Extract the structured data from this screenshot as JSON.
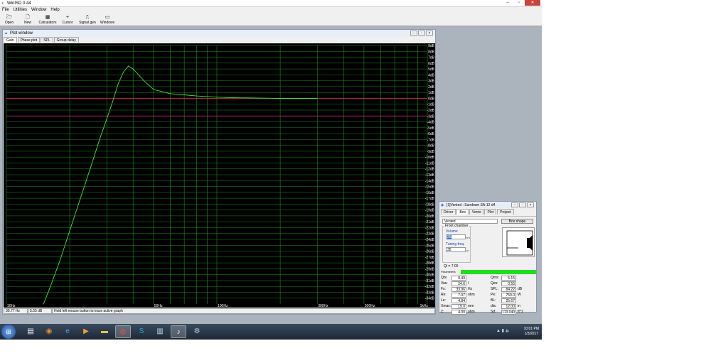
{
  "window": {
    "title": "WinISD 0.44",
    "controls": [
      "–",
      "▫",
      "✕"
    ]
  },
  "menu": [
    "File",
    "Utilities",
    "Window",
    "Help"
  ],
  "toolbar": [
    {
      "label": "Open",
      "icon": "open-folder-icon"
    },
    {
      "label": "New",
      "icon": "new-document-icon"
    },
    {
      "label": "Calculators",
      "icon": "calculator-icon"
    },
    {
      "label": "Cursor",
      "icon": "crosshair-icon"
    },
    {
      "label": "Signal gen",
      "icon": "signal-generator-icon"
    },
    {
      "label": "Windows",
      "icon": "windows-icon"
    }
  ],
  "plot_window": {
    "title": "Plot window",
    "tabs": [
      "Gain",
      "Phase plot",
      "SPL",
      "Group delay"
    ],
    "active_tab": "Gain",
    "status": {
      "freq": "30.77 Hz",
      "value": "5.55 dB",
      "hint": "Hold left mouse button to trace active graph"
    }
  },
  "colors": {
    "plot_bg": "#000000",
    "grid": "#1f8a1f",
    "curve": "#3ee83e",
    "ref_line": "#d03030",
    "minus3_line": "#b03090",
    "progress": "#22dd22"
  },
  "chart_data": {
    "type": "line",
    "x_scale": "log",
    "xlim": [
      10,
      1000
    ],
    "ylim": [
      -35,
      9
    ],
    "x_tick_labels": [
      {
        "value": 10,
        "label": "10Hz"
      },
      {
        "value": 50,
        "label": "50Hz"
      },
      {
        "value": 100,
        "label": "100Hz"
      },
      {
        "value": 300,
        "label": "300Hz"
      },
      {
        "value": 500,
        "label": "500Hz"
      },
      {
        "value": 1000,
        "label": "1kHz"
      }
    ],
    "y_tick_labels": [
      "9dB",
      "8dB",
      "7dB",
      "6dB",
      "5dB",
      "4dB",
      "3dB",
      "2dB",
      "1dB",
      "0dB",
      "-1dB",
      "-2dB",
      "-3dB",
      "-4dB",
      "-5dB",
      "-6dB",
      "-7dB",
      "-8dB",
      "-9dB",
      "-10dB",
      "-11dB",
      "-12dB",
      "-13dB",
      "-14dB",
      "-15dB",
      "-16dB",
      "-17dB",
      "-18dB",
      "-19dB",
      "-20dB",
      "-21dB",
      "-22dB",
      "-23dB",
      "-24dB",
      "-25dB",
      "-26dB",
      "-27dB",
      "-28dB",
      "-29dB",
      "-30dB",
      "-31dB",
      "-32dB",
      "-33dB",
      "-34dB"
    ],
    "y_tick_values": [
      9,
      8,
      7,
      6,
      5,
      4,
      3,
      2,
      1,
      0,
      -1,
      -2,
      -3,
      -4,
      -5,
      -6,
      -7,
      -8,
      -9,
      -10,
      -11,
      -12,
      -13,
      -14,
      -15,
      -16,
      -17,
      -18,
      -19,
      -20,
      -21,
      -22,
      -23,
      -24,
      -25,
      -26,
      -27,
      -28,
      -29,
      -30,
      -31,
      -32,
      -33,
      -34
    ],
    "reference_lines": [
      0,
      -3
    ],
    "series": [
      {
        "x": [
          15,
          16,
          18,
          20,
          22,
          25,
          28,
          30,
          32,
          34,
          36,
          38,
          40,
          45,
          50,
          60,
          70,
          80,
          100,
          120,
          150,
          200,
          250,
          300
        ],
        "y": [
          -35,
          -32.5,
          -27.5,
          -22.5,
          -18,
          -12,
          -6.5,
          -3.5,
          -0.5,
          2.5,
          4.5,
          5.5,
          5.0,
          3.0,
          1.5,
          0.8,
          0.6,
          0.4,
          0.2,
          0.1,
          0.05,
          0.0,
          0.0,
          0.0
        ]
      }
    ]
  },
  "box_window": {
    "title": "[1]Vented : Sundown SA-12 d4",
    "tabs": [
      "Driver",
      "Box",
      "Vents",
      "Plot",
      "Project"
    ],
    "active_tab": "Box",
    "box_type": "Vented",
    "box_shape_label": "Box shape",
    "front_chamber_label": "Front chamber",
    "volume_label": "Volume",
    "volume_value": "35",
    "volume_unit": "ft^3",
    "tuning_label": "Tuning freq.",
    "tuning_value": "35",
    "tuning_unit": "Hz",
    "ql_text": "Ql = 7.00",
    "params_label": "Parameters",
    "params_left": [
      {
        "name": "Qts:",
        "value": "0.49",
        "unit": ""
      },
      {
        "name": "Vas:",
        "value": "24.6",
        "unit": "l"
      },
      {
        "name": "Fs:",
        "value": "33.96",
        "unit": "Hz"
      },
      {
        "name": "Re:",
        "value": "7.07",
        "unit": "ohm"
      },
      {
        "name": "Le:",
        "value": "4.84",
        "unit": ""
      },
      {
        "name": "Xmax:",
        "value": "19.0",
        "unit": "mm"
      },
      {
        "name": "Z:",
        "value": "4.00",
        "unit": "ohm"
      }
    ],
    "params_right": [
      {
        "name": "Qms:",
        "value": "5.15",
        "unit": ""
      },
      {
        "name": "Qes:",
        "value": "0.55",
        "unit": ""
      },
      {
        "name": "SPL:",
        "value": "84.22",
        "unit": "dB"
      },
      {
        "name": "Pe:",
        "value": "750.0",
        "unit": "W"
      },
      {
        "name": "BL:",
        "value": "25.67",
        "unit": ""
      },
      {
        "name": "dia:",
        "value": "12.00",
        "unit": "in"
      },
      {
        "name": "Sd:",
        "value": "113.040",
        "unit": "ft^2"
      }
    ]
  },
  "taskbar": {
    "icons": [
      "windows-explorer-icon",
      "firefox-icon",
      "internet-explorer-icon",
      "media-player-icon",
      "folder-icon",
      "chrome-icon",
      "skype-icon",
      "notepad-icon",
      "winisd-icon",
      "paint-icon"
    ],
    "clock_time": "10:01 PM",
    "clock_date": "1/3/2017"
  }
}
